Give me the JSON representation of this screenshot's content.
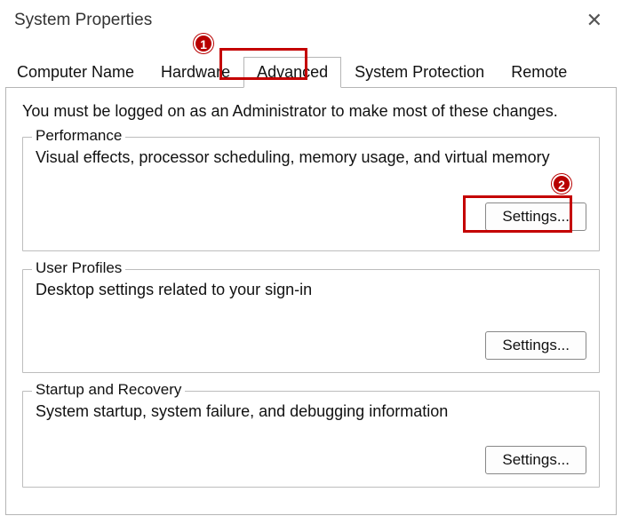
{
  "window": {
    "title": "System Properties"
  },
  "tabs": {
    "items": [
      {
        "label": "Computer Name",
        "active": false
      },
      {
        "label": "Hardware",
        "active": false
      },
      {
        "label": "Advanced",
        "active": true
      },
      {
        "label": "System Protection",
        "active": false
      },
      {
        "label": "Remote",
        "active": false
      }
    ]
  },
  "panel": {
    "admin_msg": "You must be logged on as an Administrator to make most of these changes."
  },
  "groups": {
    "performance": {
      "legend": "Performance",
      "desc": "Visual effects, processor scheduling, memory usage, and virtual memory",
      "button": "Settings..."
    },
    "user_profiles": {
      "legend": "User Profiles",
      "desc": "Desktop settings related to your sign-in",
      "button": "Settings..."
    },
    "startup": {
      "legend": "Startup and Recovery",
      "desc": "System startup, system failure, and debugging information",
      "button": "Settings..."
    }
  },
  "annotations": {
    "colors": {
      "highlight": "#c40000",
      "badge_bg": "#b80000"
    },
    "badge1": "1",
    "badge2": "2"
  }
}
